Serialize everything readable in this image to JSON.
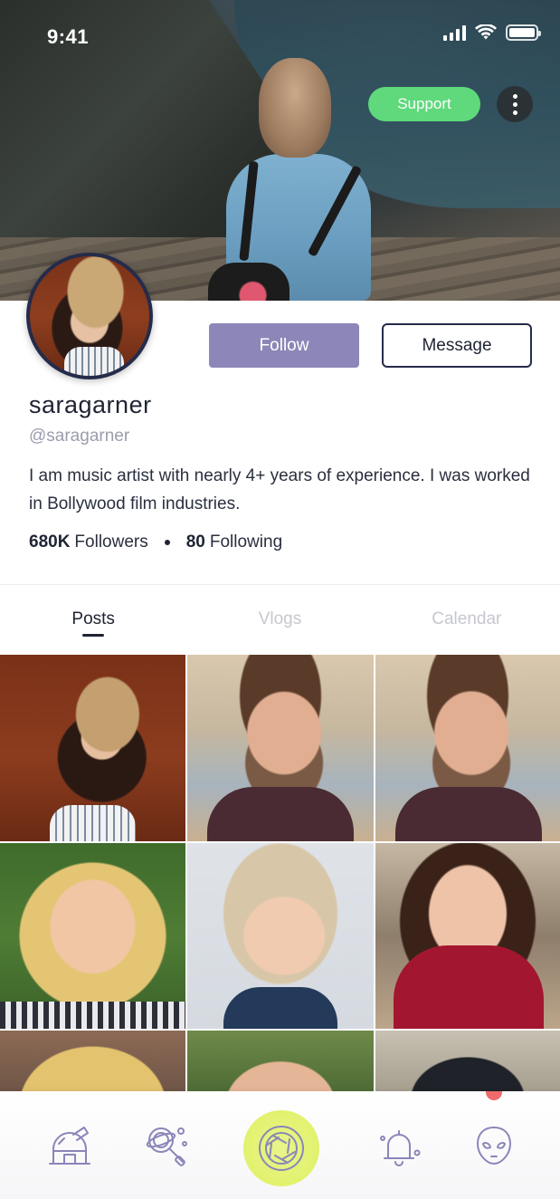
{
  "status_bar": {
    "time": "9:41"
  },
  "header": {
    "support_label": "Support",
    "more_icon": "more-vertical-icon"
  },
  "profile": {
    "display_name": "saragarner",
    "handle": "@saragarner",
    "bio": "I am music artist with nearly 4+ years of experience. I was worked in Bollywood film industries.",
    "followers_count": "680K",
    "followers_label": "Followers",
    "following_count": "80",
    "following_label": "Following"
  },
  "actions": {
    "follow_label": "Follow",
    "message_label": "Message"
  },
  "tabs": [
    {
      "label": "Posts",
      "active": true
    },
    {
      "label": "Vlogs",
      "active": false
    },
    {
      "label": "Calendar",
      "active": false
    }
  ],
  "posts": [
    {
      "subject": "woman in straw hat"
    },
    {
      "subject": "bearded man"
    },
    {
      "subject": "bearded man"
    },
    {
      "subject": "blonde woman smiling"
    },
    {
      "subject": "woman with short blonde hair"
    },
    {
      "subject": "woman in red sweater laughing"
    },
    {
      "subject": "woman with blonde hair"
    },
    {
      "subject": "man outdoors"
    },
    {
      "subject": "person with dark hair"
    }
  ],
  "bottom_nav": [
    {
      "icon": "observatory-icon"
    },
    {
      "icon": "planet-search-icon"
    },
    {
      "icon": "camera-aperture-icon"
    },
    {
      "icon": "notification-bell-icon"
    },
    {
      "icon": "alien-icon"
    }
  ],
  "colors": {
    "accent": "#8c87b8",
    "support_green": "#5fd97c",
    "camera_lime": "#e2f26d",
    "text_dark": "#1f2433",
    "text_muted": "#9b9cad",
    "icon_purple": "#8a86b8"
  }
}
